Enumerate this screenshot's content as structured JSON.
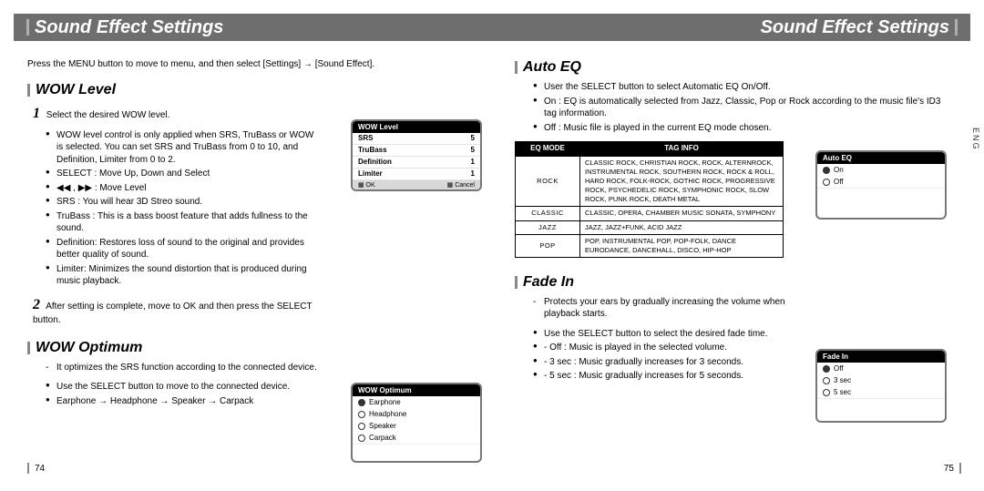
{
  "header": {
    "title_left": "Sound Effect Settings",
    "title_right": "Sound Effect Settings"
  },
  "lang_tab": "ENG",
  "intro": "Press the MENU button to move to menu, and then select [Settings] → [Sound Effect].",
  "wow_level": {
    "heading": "WOW Level",
    "step1": "Select the desired WOW level.",
    "bullets1": [
      "WOW level control is only applied when SRS, TruBass or WOW is selected. You can set SRS and TruBass from 0 to 10, and Definition, Limiter from 0 to 2.",
      "SELECT : Move Up, Down and Select",
      "◀◀ , ▶▶ : Move Level",
      "SRS : You will hear 3D Streo sound.",
      "TruBass : This is a bass boost feature that adds fullness to the sound.",
      "Definition: Restores loss of sound to the original and provides better quality of sound.",
      "Limiter: Minimizes the sound distortion that is produced during music playback."
    ],
    "step2": "After setting is complete, move to OK and then press the SELECT button.",
    "device": {
      "title": "WOW Level",
      "rows": [
        {
          "label": "SRS",
          "val": "5"
        },
        {
          "label": "TruBass",
          "val": "5"
        },
        {
          "label": "Definition",
          "val": "1"
        },
        {
          "label": "Limiter",
          "val": "1"
        }
      ],
      "foot_ok": "▦ OK",
      "foot_cancel": "▦ Cancel"
    }
  },
  "wow_optimum": {
    "heading": "WOW Optimum",
    "lead": "It optimizes the SRS function according to the connected device.",
    "bullets": [
      "Use the SELECT button to move to the connected device.",
      "Earphone → Headphone → Speaker → Carpack"
    ],
    "device": {
      "title": "WOW Optimum",
      "options": [
        {
          "label": "Earphone",
          "selected": true
        },
        {
          "label": "Headphone",
          "selected": false
        },
        {
          "label": "Speaker",
          "selected": false
        },
        {
          "label": "Carpack",
          "selected": false
        }
      ]
    }
  },
  "auto_eq": {
    "heading": "Auto EQ",
    "bullets": [
      "User the SELECT button to select Automatic EQ On/Off.",
      "On : EQ is automatically selected from Jazz, Classic, Pop or Rock according to the music file's ID3 tag information.",
      "Off : Music file is played in the current EQ mode chosen."
    ],
    "table": {
      "head_mode": "EQ Mode",
      "head_tag": "Tag Info",
      "rows": [
        {
          "mode": "ROCK",
          "info": "CLASSIC ROCK, CHRISTIAN ROCK, ROCK, ALTERNROCK, INSTRUMENTAL ROCK, SOUTHERN ROCK, ROCK & ROLL, HARD ROCK, FOLK-ROCK, GOTHIC ROCK, PROGRESSIVE ROCK, PSYCHEDELIC ROCK, SYMPHONIC ROCK, SLOW ROCK, PUNK ROCK, DEATH METAL"
        },
        {
          "mode": "CLASSIC",
          "info": "CLASSIC, OPERA, CHAMBER MUSIC SONATA, SYMPHONY"
        },
        {
          "mode": "JAZZ",
          "info": "JAZZ, JAZZ+FUNK, ACID JAZZ"
        },
        {
          "mode": "POP",
          "info": "POP, INSTRUMENTAL POP, POP-FOLK, DANCE EURODANCE, DANCEHALL, DISCO, HIP-HOP"
        }
      ]
    },
    "device": {
      "title": "Auto EQ",
      "options": [
        {
          "label": "On",
          "selected": true
        },
        {
          "label": "Off",
          "selected": false
        }
      ]
    }
  },
  "fade_in": {
    "heading": "Fade In",
    "lead": "Protects your ears by gradually increasing the volume when playback starts.",
    "bullets": [
      "Use the SELECT button to select the desired fade time.",
      "- Off : Music is played in the selected volume.",
      "- 3 sec : Music gradually increases for 3 seconds.",
      "- 5 sec : Music gradually increases for 5 seconds."
    ],
    "device": {
      "title": "Fade In",
      "options": [
        {
          "label": "Off",
          "selected": true
        },
        {
          "label": "3 sec",
          "selected": false
        },
        {
          "label": "5 sec",
          "selected": false
        }
      ]
    }
  },
  "page_numbers": {
    "left": "74",
    "right": "75"
  }
}
